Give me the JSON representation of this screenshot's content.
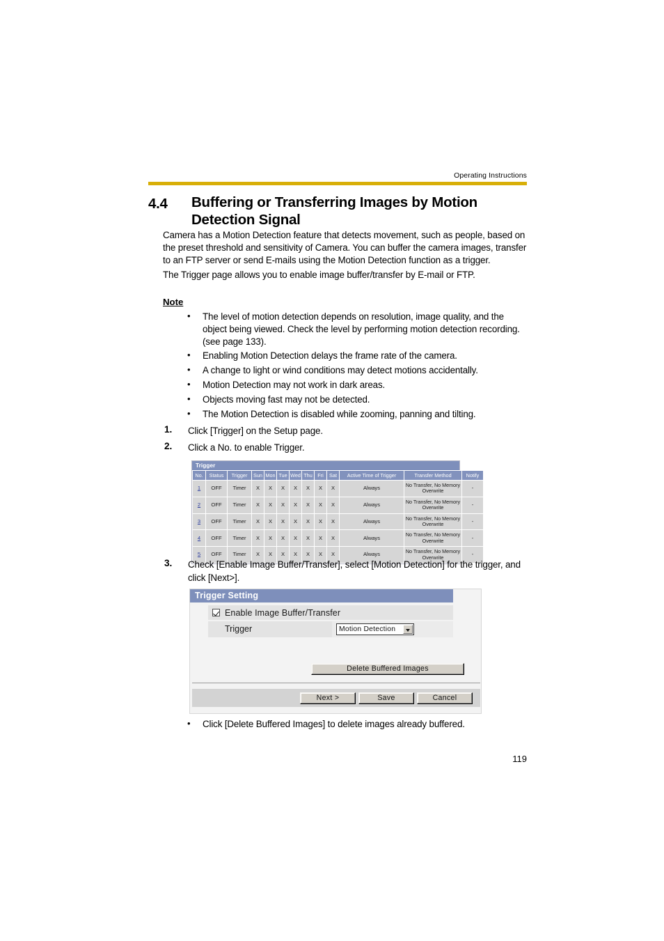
{
  "header": {
    "running_head": "Operating Instructions",
    "rule_color": "#d8af08"
  },
  "section": {
    "number": "4.4",
    "title": "Buffering or Transferring Images by Motion Detection Signal"
  },
  "body": {
    "paragraph1": "Camera has a Motion Detection feature that detects movement, such as people, based on the preset threshold and sensitivity of Camera. You can buffer the camera images, transfer to an FTP server or send E-mails using the Motion Detection function as a trigger.",
    "paragraph2": "The Trigger page allows you to enable image buffer/transfer by E-mail or FTP."
  },
  "note": {
    "heading": "Note",
    "bullet_glyph": "•",
    "items": [
      "The level of motion detection depends on resolution, image quality, and the object being viewed. Check the level by performing motion detection recording. (see page 133).",
      "Enabling Motion Detection delays the frame rate of the camera.",
      "A change to light or wind conditions may detect motions accidentally.",
      "Motion Detection may not work in dark areas.",
      "Objects moving fast may not be detected.",
      "The Motion Detection is disabled while zooming, panning and tilting."
    ]
  },
  "steps": [
    {
      "number": "1.",
      "text": "Click [Trigger] on the Setup page."
    },
    {
      "number": "2.",
      "text": "Click a No. to enable Trigger."
    },
    {
      "number": "3.",
      "text": "Check [Enable Image Buffer/Transfer], select [Motion Detection] for the trigger, and click [Next>]."
    }
  ],
  "trigger_table": {
    "title": "Trigger",
    "title_bar_color": "#7e8fbb",
    "header_color": "#8292bd",
    "row_color": "#d6d6d6",
    "link_color": "#2b3c9e",
    "columns": [
      "No.",
      "Status",
      "Trigger",
      "Sun",
      "Mon",
      "Tue",
      "Wed",
      "Thu",
      "Fri",
      "Sat",
      "Active Time of Trigger",
      "Transfer Method",
      "Notify"
    ],
    "rows": [
      {
        "no": "1",
        "status": "OFF",
        "trigger": "Timer",
        "sun": "X",
        "mon": "X",
        "tue": "X",
        "wed": "X",
        "thu": "X",
        "fri": "X",
        "sat": "X",
        "active_time": "Always",
        "transfer_method": "No Transfer, No Memory Overwrite",
        "notify": "-"
      },
      {
        "no": "2",
        "status": "OFF",
        "trigger": "Timer",
        "sun": "X",
        "mon": "X",
        "tue": "X",
        "wed": "X",
        "thu": "X",
        "fri": "X",
        "sat": "X",
        "active_time": "Always",
        "transfer_method": "No Transfer, No Memory Overwrite",
        "notify": "-"
      },
      {
        "no": "3",
        "status": "OFF",
        "trigger": "Timer",
        "sun": "X",
        "mon": "X",
        "tue": "X",
        "wed": "X",
        "thu": "X",
        "fri": "X",
        "sat": "X",
        "active_time": "Always",
        "transfer_method": "No Transfer, No Memory Overwrite",
        "notify": "-"
      },
      {
        "no": "4",
        "status": "OFF",
        "trigger": "Timer",
        "sun": "X",
        "mon": "X",
        "tue": "X",
        "wed": "X",
        "thu": "X",
        "fri": "X",
        "sat": "X",
        "active_time": "Always",
        "transfer_method": "No Transfer, No Memory Overwrite",
        "notify": "-"
      },
      {
        "no": "5",
        "status": "OFF",
        "trigger": "Timer",
        "sun": "X",
        "mon": "X",
        "tue": "X",
        "wed": "X",
        "thu": "X",
        "fri": "X",
        "sat": "X",
        "active_time": "Always",
        "transfer_method": "No Transfer, No Memory Overwrite",
        "notify": "-"
      }
    ]
  },
  "trigger_setting": {
    "title": "Trigger Setting",
    "title_bar_color": "#7e8fbb",
    "enable_checkbox_label": "Enable Image Buffer/Transfer",
    "enable_checkbox_checked": true,
    "trigger_label": "Trigger",
    "trigger_selected": "Motion Detection",
    "delete_button": "Delete Buffered Images",
    "next_button": "Next >",
    "save_button": "Save",
    "cancel_button": "Cancel"
  },
  "trailing_note": {
    "bullet_glyph": "•",
    "text": "Click [Delete Buffered Images] to delete images already buffered."
  },
  "footer": {
    "page_number": "119"
  }
}
